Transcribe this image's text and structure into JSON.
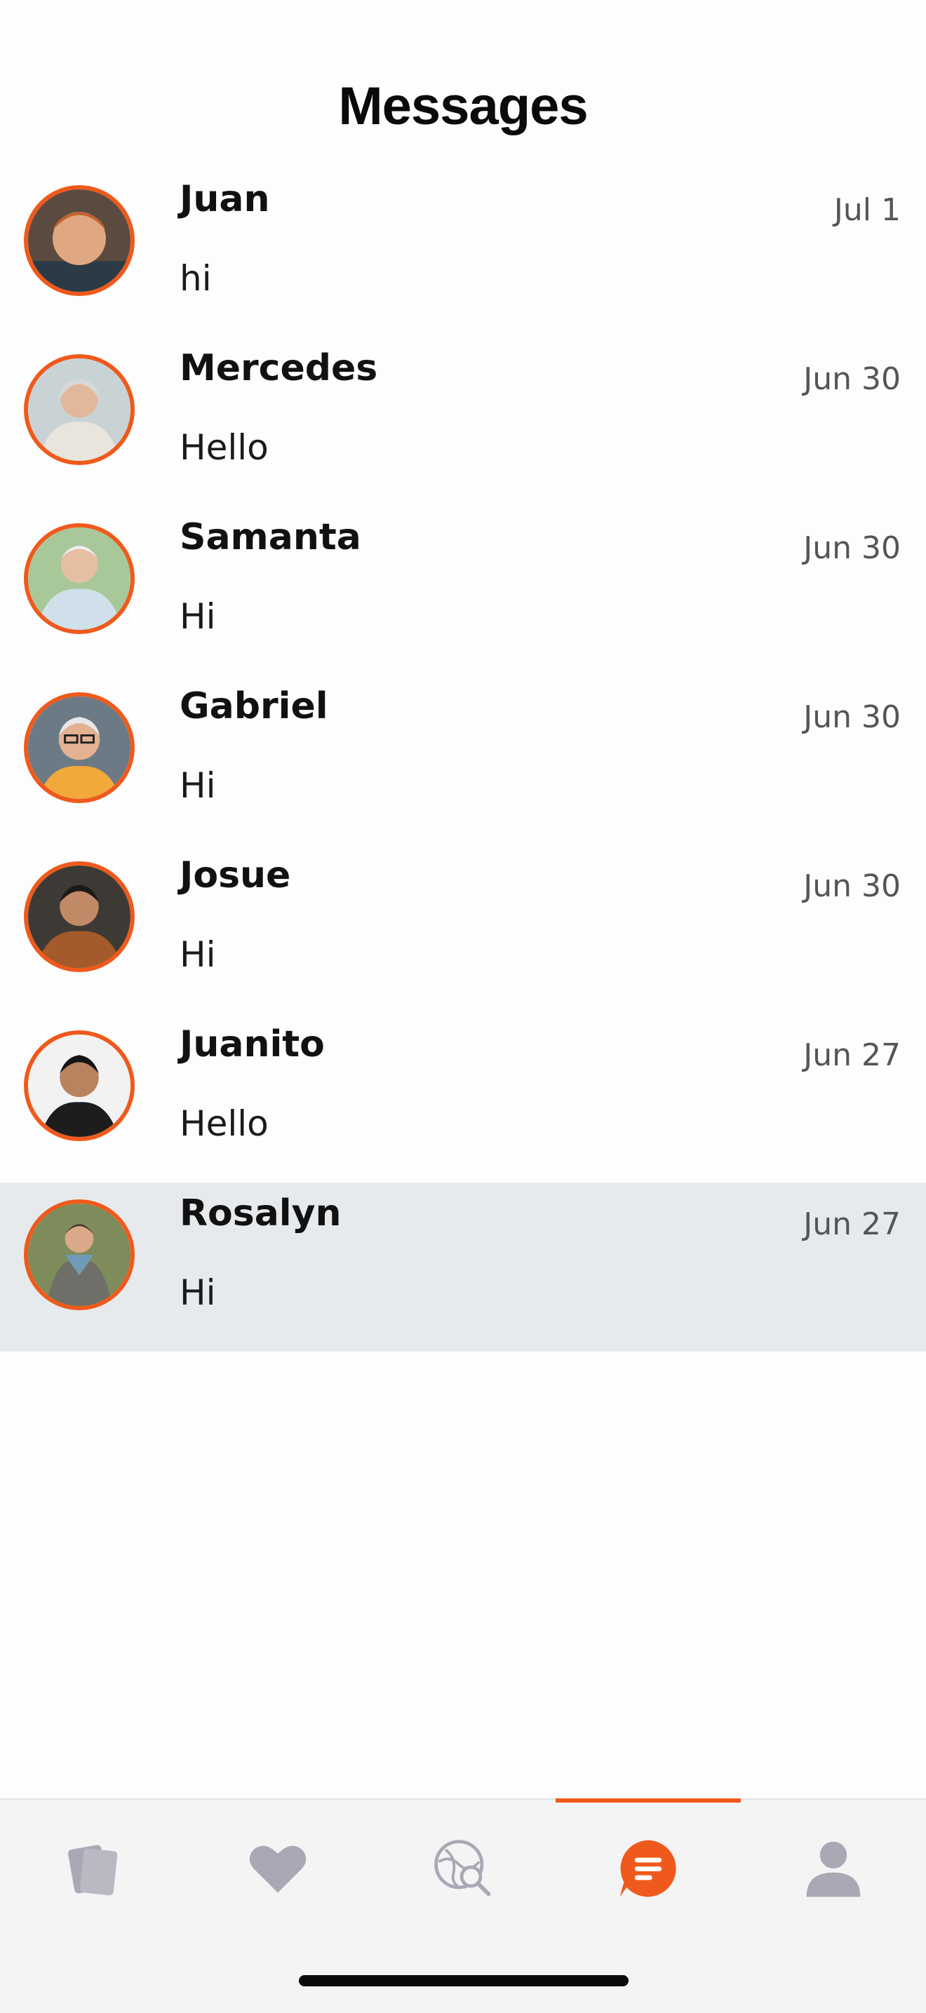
{
  "header": {
    "title": "Messages"
  },
  "conversations": [
    {
      "name": "Juan",
      "preview": "hi",
      "date": "Jul 1"
    },
    {
      "name": "Mercedes",
      "preview": "Hello",
      "date": "Jun 30"
    },
    {
      "name": "Samanta",
      "preview": "Hi",
      "date": "Jun 30"
    },
    {
      "name": "Gabriel",
      "preview": "Hi",
      "date": "Jun 30"
    },
    {
      "name": "Josue",
      "preview": "Hi",
      "date": "Jun 30"
    },
    {
      "name": "Juanito",
      "preview": "Hello",
      "date": "Jun 27"
    },
    {
      "name": "Rosalyn",
      "preview": "Hi",
      "date": "Jun 27"
    }
  ],
  "tabbar": {
    "items": [
      {
        "icon": "cards-icon",
        "active": false
      },
      {
        "icon": "heart-icon",
        "active": false
      },
      {
        "icon": "globe-search-icon",
        "active": false
      },
      {
        "icon": "chat-icon",
        "active": true
      },
      {
        "icon": "profile-icon",
        "active": false
      }
    ]
  },
  "colors": {
    "accent": "#ef5a1c",
    "selected_row": "#e7eaed",
    "inactive_icon": "#a9a9b5"
  }
}
